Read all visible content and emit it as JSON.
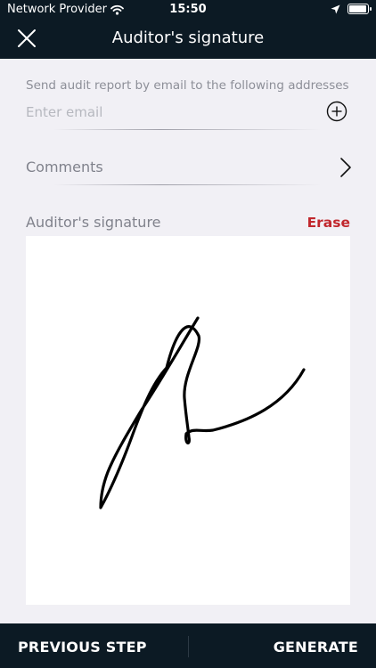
{
  "status_bar": {
    "carrier": "Network Provider",
    "time": "15:50",
    "battery_level": 0.95
  },
  "header": {
    "title": "Auditor's signature",
    "close_icon": "close-icon"
  },
  "form": {
    "email_hint": "Send audit report by email to the following addresses",
    "email_placeholder": "Enter email",
    "email_value": "",
    "add_icon": "plus-circle-icon",
    "comments_label": "Comments",
    "comments_icon": "chevron-right-icon",
    "signature_label": "Auditor's signature",
    "erase_label": "Erase"
  },
  "footer": {
    "previous_label": "PREVIOUS STEP",
    "generate_label": "GENERATE"
  },
  "colors": {
    "bar_background": "#0c1a24",
    "page_background": "#f1f0f5",
    "erase": "#c1272d"
  }
}
